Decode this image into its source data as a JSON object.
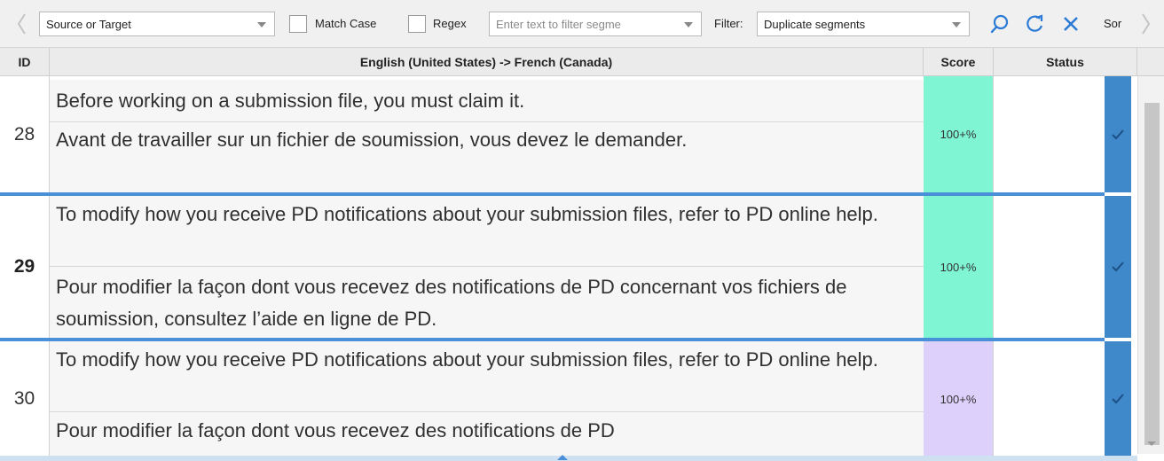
{
  "toolbar": {
    "scope_value": "Source or Target",
    "match_case_label": "Match Case",
    "regex_label": "Regex",
    "filter_text_placeholder": "Enter text to filter segme",
    "filter_label": "Filter:",
    "filter_value": "Duplicate segments",
    "sort_label": "Sor",
    "icons": [
      "chevron-left-icon",
      "search-icon",
      "refresh-icon",
      "close-icon",
      "chevron-right-icon"
    ],
    "icon_color": "#2b7bd6"
  },
  "header": {
    "id": "ID",
    "languages": "English (United States) -> French (Canada)",
    "score": "Score",
    "status": "Status"
  },
  "segments": [
    {
      "id": "28",
      "source": "Before working on a submission file, you must claim it.",
      "target": "Avant de travailler sur un fichier de soumission, vous devez le demander.",
      "score": "100+%",
      "score_color": "#7ff5d3",
      "confirmed": true,
      "active": false
    },
    {
      "id": "29",
      "source": "To modify how you receive PD notifications about your submission files, refer to PD online help.",
      "target": "Pour modifier la façon dont vous recevez des notifications de PD concernant vos fichiers de soumission, consultez l’aide en ligne de PD.",
      "score": "100+%",
      "score_color": "#7ff5d3",
      "confirmed": true,
      "active": true
    },
    {
      "id": "30",
      "source": "To modify how you receive PD notifications about your submission files, refer to PD online help.",
      "target": "Pour modifier la façon dont vous recevez des notifications de PD",
      "score": "100+%",
      "score_color": "#ddd0fb",
      "confirmed": true,
      "active": false
    }
  ],
  "colors": {
    "confirm_column": "#3f88c9",
    "separator": "#4a90d9"
  }
}
